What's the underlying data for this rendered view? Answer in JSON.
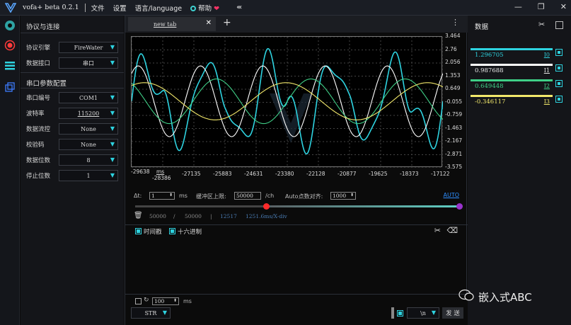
{
  "app": {
    "title": "vofa+ beta 0.2.1",
    "menu": [
      "文件",
      "设置",
      "语言/language",
      "帮助"
    ]
  },
  "left_panel": {
    "section1_title": "协议与连接",
    "protocol_label": "协议引擎",
    "protocol_value": "FireWater",
    "port_label": "数据接口",
    "port_value": "串口",
    "section2_title": "串口参数配置",
    "fields": [
      {
        "label": "串口编号",
        "value": "COM1"
      },
      {
        "label": "波特率",
        "value": "115200"
      },
      {
        "label": "数据流控",
        "value": "None"
      },
      {
        "label": "校验码",
        "value": "None"
      },
      {
        "label": "数据位数",
        "value": "8"
      },
      {
        "label": "停止位数",
        "value": "1"
      }
    ]
  },
  "tab": {
    "label": "new tab"
  },
  "chart_data": {
    "type": "line",
    "y_ticks": [
      "3.464",
      "2.76",
      "2.056",
      "1.353",
      "0.649",
      "-0.055",
      "-0.759",
      "-1.463",
      "-2.167",
      "-2.871",
      "-3.575"
    ],
    "x_ticks": [
      "-29638",
      "-28386",
      "-27135",
      "-25883",
      "-24631",
      "-23380",
      "-22128",
      "-20877",
      "-19625",
      "-18373",
      "-17122"
    ],
    "x_unit": "ms",
    "ylim": [
      -3.575,
      3.464
    ],
    "xlim": [
      -29638,
      -17122
    ],
    "grid": true,
    "series": [
      {
        "color": "#2ed3e0"
      },
      {
        "color": "#ffffff"
      },
      {
        "color": "#3fcf87"
      },
      {
        "color": "#f2e86b"
      }
    ]
  },
  "controls": {
    "dt_label": "Δt:",
    "dt_value": "1",
    "dt_unit": "ms",
    "buffer_label": "缓冲区上限:",
    "buffer_value": "50000",
    "buffer_unit": "/ch",
    "auto_label": "Auto点数对齐:",
    "auto_value": "1000",
    "auto_button": "AUTO",
    "slider_start": 0.4,
    "slider_end": 1.0
  },
  "stats": {
    "count": "50000",
    "sep": "/",
    "total": "50000",
    "bar": "|",
    "points": "12517",
    "xdiv": "1251.6ms/X-div"
  },
  "receive": {
    "timestamp_label": "时间戳",
    "hex_label": "十六进制"
  },
  "send": {
    "interval_value": "100",
    "interval_unit": "ms",
    "format_value": "STR",
    "terminator_value": "\\n",
    "send_button": "发 送"
  },
  "right_panel": {
    "title": "数据",
    "channels": [
      {
        "value": "1.296705",
        "name": "I0",
        "color": "#2ed3e0"
      },
      {
        "value": "0.987688",
        "name": "I1",
        "color": "#ffffff"
      },
      {
        "value": "0.649448",
        "name": "I2",
        "color": "#3fcf87"
      },
      {
        "value": "-0.346117",
        "name": "I3",
        "color": "#f2e86b"
      }
    ]
  },
  "watermark": "嵌入式ABC"
}
